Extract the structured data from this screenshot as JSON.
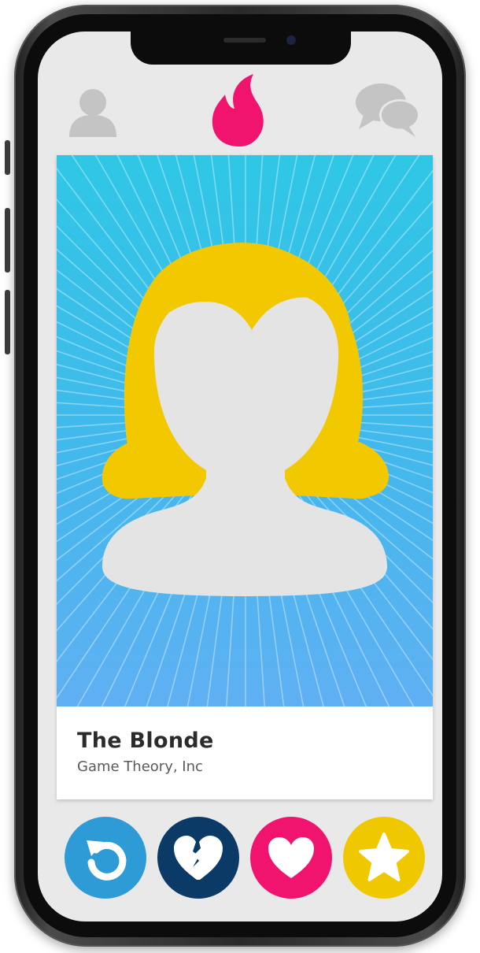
{
  "profile": {
    "name": "The Blonde",
    "subtitle": "Game Theory, Inc"
  },
  "colors": {
    "accent": "#f0146e",
    "rewind": "#2f9bd6",
    "nope": "#0c3a66",
    "like": "#f0146e",
    "superlike": "#f0c800",
    "hair": "#f2c800",
    "face": "#e4e4e4",
    "top_icons": "#c4c4c4"
  },
  "icons": {
    "profile": "person-icon",
    "app_logo": "flame-icon",
    "messages": "chat-bubbles-icon",
    "rewind": "rewind-icon",
    "nope": "broken-heart-icon",
    "like": "heart-icon",
    "superlike": "star-icon"
  }
}
